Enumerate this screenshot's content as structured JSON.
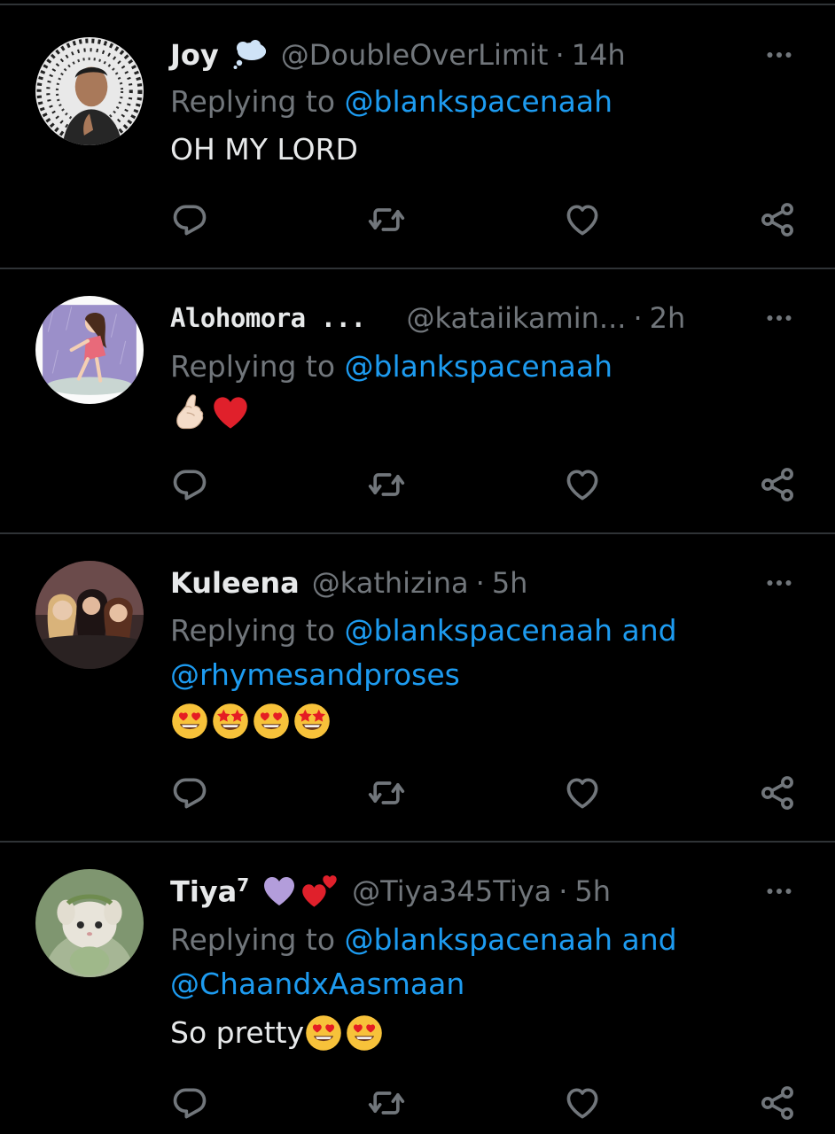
{
  "tweets": [
    {
      "name": "Joy",
      "handle": "@DoubleOverLimit",
      "sep": "·",
      "time": "14h",
      "replying_prefix": "Replying to ",
      "mention1": "@blankspacenaah",
      "text": "OH MY LORD",
      "name_icon": "thought-bubble-icon"
    },
    {
      "name": "Alohomora ...",
      "handle": "@kataiikamin...",
      "sep": "·",
      "time": "2h",
      "replying_prefix": "Replying to ",
      "mention1": "@blankspacenaah",
      "text": "",
      "emojis": [
        "pinched-fingers-emoji",
        "red-heart-emoji"
      ]
    },
    {
      "name": "Kuleena",
      "handle": "@kathizina",
      "sep": "·",
      "time": "5h",
      "replying_prefix": "Replying to ",
      "mention1": "@blankspacenaah",
      "and": " and",
      "mention2": "@rhymesandproses",
      "emojis": [
        "heart-eyes-emoji",
        "star-struck-emoji",
        "heart-eyes-emoji",
        "star-struck-emoji"
      ]
    },
    {
      "name": "Tiya",
      "name_sup": "7",
      "handle": "@Tiya345Tiya",
      "sep": "·",
      "time": "5h",
      "replying_prefix": "Replying to ",
      "mention1": "@blankspacenaah",
      "and": " and",
      "mention2": "@ChaandxAasmaan",
      "text": "So pretty",
      "emojis": [
        "heart-eyes-emoji",
        "heart-eyes-emoji"
      ],
      "name_icons": [
        "purple-heart-icon",
        "two-hearts-icon"
      ]
    }
  ],
  "actions": [
    "reply-icon",
    "retweet-icon",
    "like-icon",
    "share-icon"
  ],
  "colors": {
    "background": "#000000",
    "text": "#e7e9ea",
    "muted": "#71767b",
    "link": "#1d9bf0",
    "divider": "#2f3336"
  }
}
